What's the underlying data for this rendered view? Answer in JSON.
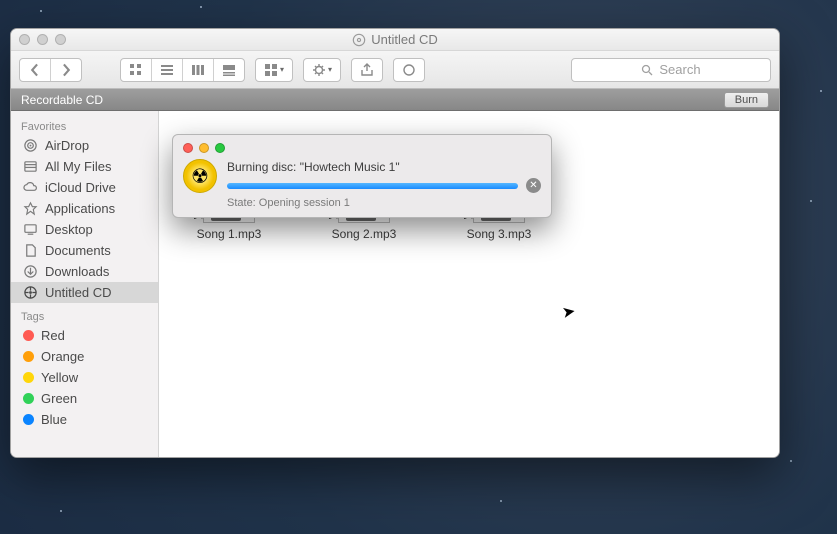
{
  "window": {
    "title": "Untitled CD"
  },
  "toolbar": {
    "search_placeholder": "Search"
  },
  "subheader": {
    "label": "Recordable CD",
    "burn_label": "Burn"
  },
  "sidebar": {
    "favorites_header": "Favorites",
    "tags_header": "Tags",
    "items": [
      {
        "label": "AirDrop"
      },
      {
        "label": "All My Files"
      },
      {
        "label": "iCloud Drive"
      },
      {
        "label": "Applications"
      },
      {
        "label": "Desktop"
      },
      {
        "label": "Documents"
      },
      {
        "label": "Downloads"
      },
      {
        "label": "Untitled CD"
      }
    ],
    "tags": [
      {
        "label": "Red",
        "color": "#ff5a52"
      },
      {
        "label": "Orange",
        "color": "#ff9f0a"
      },
      {
        "label": "Yellow",
        "color": "#ffd60a"
      },
      {
        "label": "Green",
        "color": "#30d158"
      },
      {
        "label": "Blue",
        "color": "#0a84ff"
      }
    ]
  },
  "files": [
    {
      "name": "Song 1.mp3",
      "badge": "MP3"
    },
    {
      "name": "Song 2.mp3",
      "badge": "MP3"
    },
    {
      "name": "Song 3.mp3",
      "badge": "MP3"
    }
  ],
  "dialog": {
    "title": "Burning disc: \"Howtech Music 1\"",
    "state": "State: Opening session 1",
    "progress_pct": 100
  }
}
